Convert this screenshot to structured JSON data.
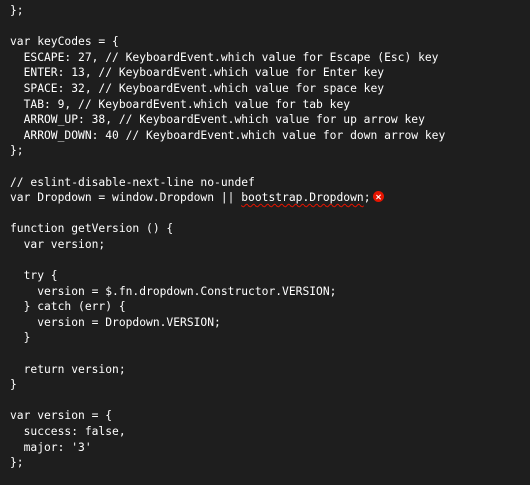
{
  "editor": {
    "lines": [
      "};",
      "",
      "var keyCodes = {",
      "  ESCAPE: 27, // KeyboardEvent.which value for Escape (Esc) key",
      "  ENTER: 13, // KeyboardEvent.which value for Enter key",
      "  SPACE: 32, // KeyboardEvent.which value for space key",
      "  TAB: 9, // KeyboardEvent.which value for tab key",
      "  ARROW_UP: 38, // KeyboardEvent.which value for up arrow key",
      "  ARROW_DOWN: 40 // KeyboardEvent.which value for down arrow key",
      "};",
      "",
      "// eslint-disable-next-line no-undef",
      "",
      "",
      "function getVersion () {",
      "  var version;",
      "",
      "  try {",
      "    version = $.fn.dropdown.Constructor.VERSION;",
      "  } catch (err) {",
      "    version = Dropdown.VERSION;",
      "  }",
      "",
      "  return version;",
      "}",
      "",
      "var version = {",
      "  success: false,",
      "  major: '3'",
      "};"
    ],
    "error_line": {
      "prefix": "var Dropdown = window.Dropdown || ",
      "flagged": "bootstrap.Dropdown",
      "suffix": ";",
      "icon": "error-circle-icon",
      "color": "#e51400"
    }
  }
}
